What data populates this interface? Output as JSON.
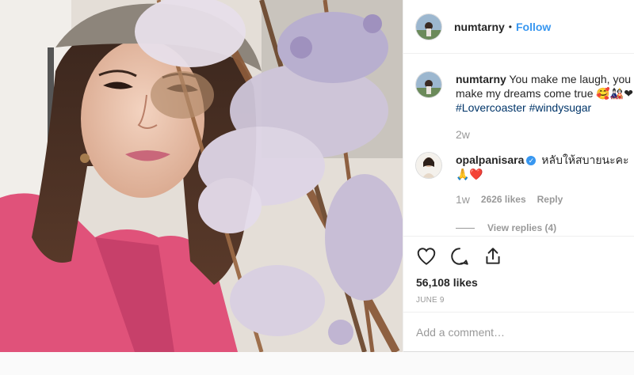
{
  "post": {
    "username": "numtarny",
    "follow_label": "Follow",
    "separator": "•",
    "caption": {
      "username": "numtarny",
      "text": "You make me laugh, you make my dreams come true 🥰🎎❤",
      "hashtags": [
        "#Lovercoaster",
        "#windysugar"
      ],
      "age": "2w"
    },
    "reply": {
      "username": "opalpanisara",
      "verified_mark": "✓",
      "text": "หลับให้สบายนะคะ 🙏❤️",
      "age": "1w",
      "likes": "2626 likes",
      "reply_label": "Reply",
      "view_replies": "View replies (4)"
    },
    "likes": "56,108 likes",
    "date": "JUNE 9",
    "add_comment_placeholder": "Add a comment…",
    "icons": [
      "heart-icon",
      "comment-icon",
      "share-icon"
    ]
  },
  "colors": {
    "link": "#3897f0",
    "hashtag": "#003569",
    "muted": "#999999",
    "jacket": "#e0527a"
  }
}
